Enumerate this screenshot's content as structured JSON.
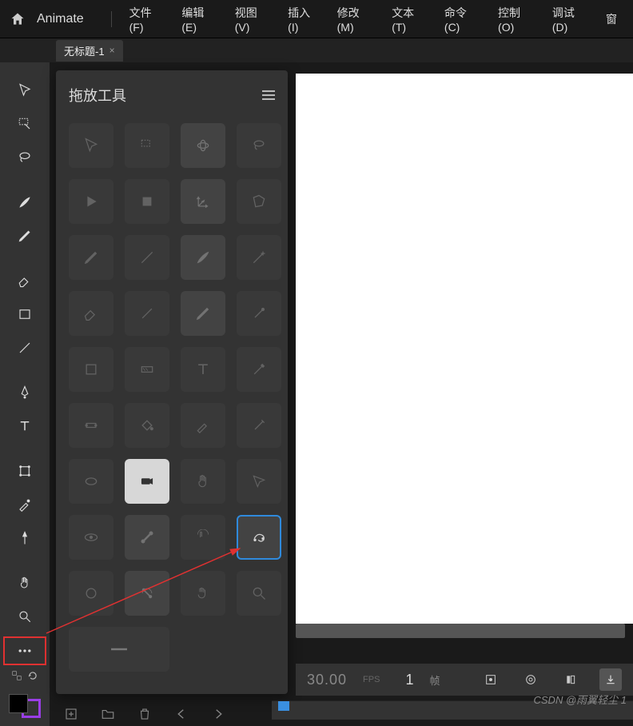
{
  "header": {
    "app_name": "Animate",
    "menu": [
      "文件(F)",
      "编辑(E)",
      "视图(V)",
      "插入(I)",
      "修改(M)",
      "文本(T)",
      "命令(C)",
      "控制(O)",
      "调试(D)",
      "窗"
    ]
  },
  "tab": {
    "title": "无标题-1",
    "close": "×"
  },
  "toolbar": {
    "items": [
      "selection-tool",
      "subselection-tool",
      "lasso-tool",
      "brush-tool",
      "pencil-tool",
      "eraser-tool",
      "rectangle-tool",
      "line-tool",
      "pen-tool",
      "text-tool",
      "free-transform-tool",
      "eyedropper-tool",
      "pin-tool",
      "hand-tool",
      "zoom-tool"
    ]
  },
  "drag_panel": {
    "title": "拖放工具"
  },
  "timeline": {
    "fps_value": "30.00",
    "fps_label": "FPS",
    "frame_value": "1",
    "frame_label": "帧"
  },
  "watermark": "CSDN @雨翼轻尘 1"
}
